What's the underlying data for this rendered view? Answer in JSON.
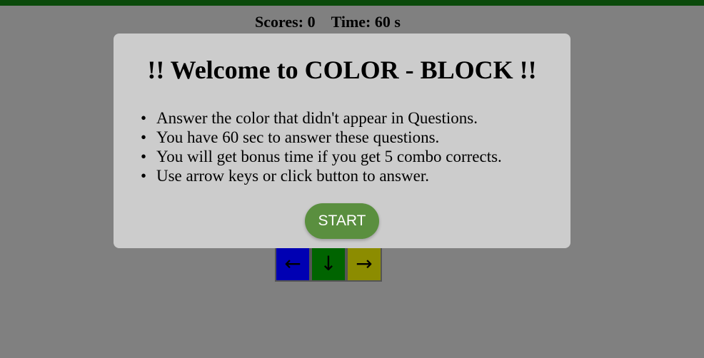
{
  "hud": {
    "scores_label": "Scores:",
    "scores_value": "0",
    "time_label": "Time:",
    "time_value": "60 s"
  },
  "modal": {
    "title": "!! Welcome to COLOR - BLOCK !!",
    "rules": [
      "Answer the color that didn't appear in Questions.",
      "You have 60 sec to answer these questions.",
      "You will get bonus time if you get 5 combo corrects.",
      "Use arrow keys or click button to answer."
    ],
    "start_label": "START"
  },
  "arrows": [
    {
      "glyph": "←",
      "color": "#0000b3",
      "icon": "arrow-left-icon"
    },
    {
      "glyph": "↓",
      "color": "#006400",
      "icon": "arrow-down-icon"
    },
    {
      "glyph": "→",
      "color": "#8c8c00",
      "icon": "arrow-right-icon"
    }
  ],
  "colors": {
    "background": "#808080",
    "topbar": "#0b4a0b",
    "modal": "#cccccc",
    "start_button": "#5a8f3f"
  }
}
